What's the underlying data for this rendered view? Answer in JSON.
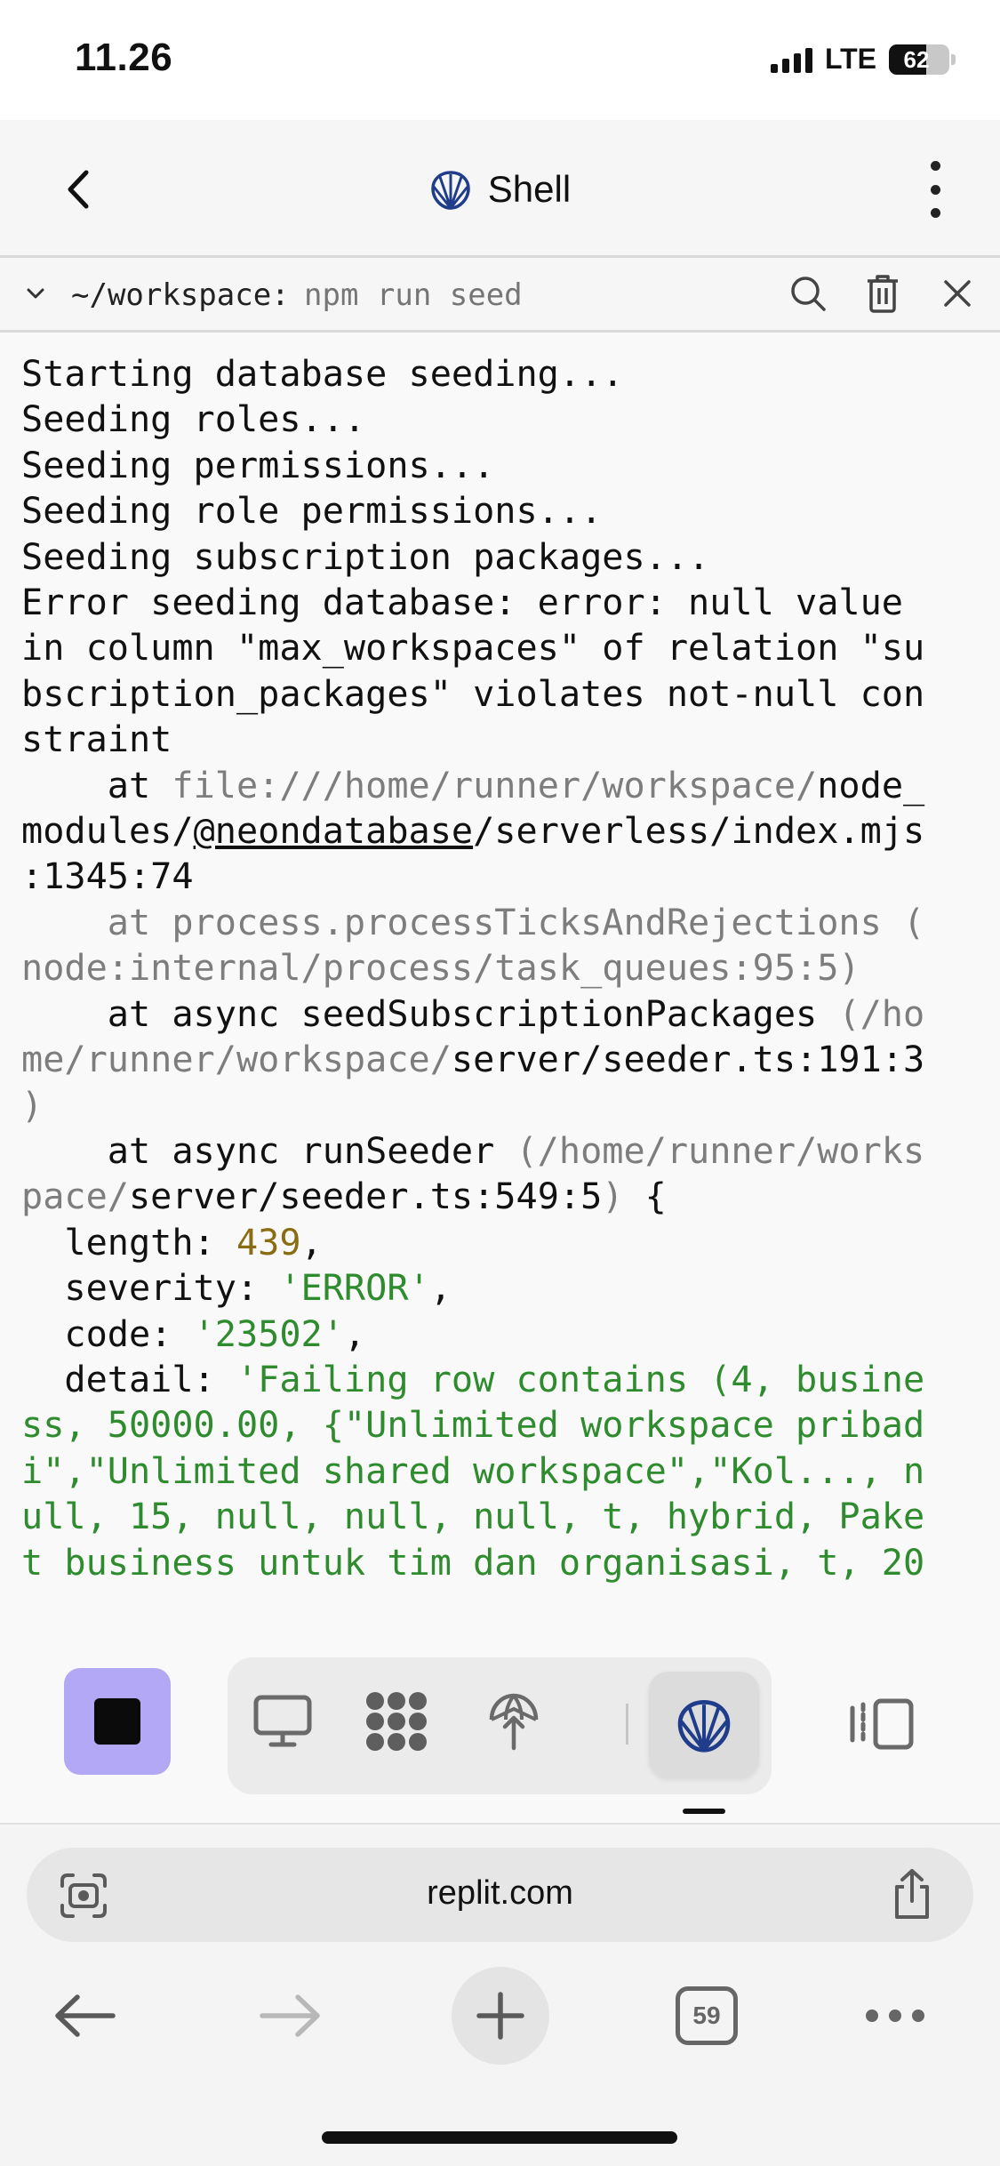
{
  "status_bar": {
    "time": "11.26",
    "network": "LTE",
    "battery_level": "62",
    "battery_fraction": 0.62
  },
  "header": {
    "title": "Shell",
    "icons": {
      "back": "chevron-left-icon",
      "logo": "shell-logo-icon",
      "menu": "more-vertical-icon"
    }
  },
  "command_bar": {
    "cwd": "~/workspace:",
    "command_placeholder": "npm run seed",
    "icons": [
      "chevron-down-icon",
      "search-icon",
      "trash-icon",
      "close-icon"
    ]
  },
  "terminal": {
    "lines": {
      "l1": "Starting database seeding...",
      "l2": "Seeding roles...",
      "l3": "Seeding permissions...",
      "l4": "Seeding role permissions...",
      "l5": "Seeding subscription packages...",
      "l6": "Error seeding database: error: null value",
      "l7": "in column \"max_workspaces\" of relation \"su",
      "l8": "bscription_packages\" violates not-null con",
      "l9": "straint",
      "l10a": "    at ",
      "l10b": "file:///home/runner/workspace/",
      "l10c": "node_",
      "l11a": "modules/",
      "l11b": "@neondatabase",
      "l11c": "/serverless/index.mjs",
      "l12": ":1345:74",
      "l13": "    at process.processTicksAndRejections (",
      "l14": "node:internal/process/task_queues:95:5)",
      "l15a": "    at async seedSubscriptionPackages ",
      "l15b": "(/ho",
      "l16a": "me/runner/workspace/",
      "l16b": "server/seeder.ts:191:3",
      "l17": ")",
      "l18a": "    at async runSeeder ",
      "l18b": "(/home/runner/works",
      "l19a": "pace/",
      "l19b": "server/seeder.ts:549:5",
      "l19c": ")",
      "l19d": " {",
      "l20a": "  length: ",
      "l20b": "439",
      "l20c": ",",
      "l21a": "  severity: ",
      "l21b": "'ERROR'",
      "l21c": ",",
      "l22a": "  code: ",
      "l22b": "'23502'",
      "l22c": ",",
      "l23a": "  detail: ",
      "l23b": "'Failing row contains (4, busine",
      "l24": "ss, 50000.00, {\"Unlimited workspace pribad",
      "l25": "i\",\"Unlimited shared workspace\",\"Kol..., n",
      "l26": "ull, 15, null, null, null, t, hybrid, Pake",
      "l27": "t business untuk tim dan organisasi, t, 20"
    }
  },
  "toolbar": {
    "stop_icon": "stop-icon",
    "tools": [
      "desktop-icon",
      "workflow-icon",
      "deploy-icon",
      "shell-icon"
    ],
    "active_tool": "shell-icon",
    "side_icon": "split-view-icon"
  },
  "browser": {
    "url": "replit.com",
    "tab_count": "59",
    "icons": [
      "page-settings-icon",
      "share-icon",
      "back-arrow-icon",
      "forward-arrow-icon",
      "new-tab-plus-icon",
      "tabs-icon",
      "more-icon"
    ]
  },
  "colors": {
    "stop_button": "#b3a8f5",
    "shell_logo": "#1f3d8a",
    "terminal_string": "#2e8b2e",
    "terminal_number": "#8a6d12",
    "terminal_dim": "#7d7d7d"
  }
}
